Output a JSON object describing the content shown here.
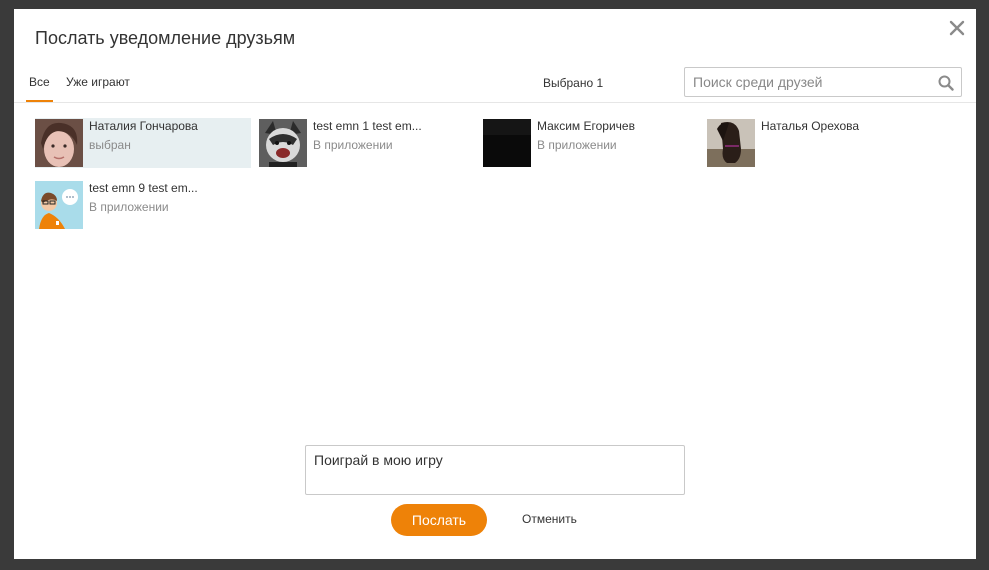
{
  "dialog": {
    "title": "Послать уведомление друзьям",
    "close_icon": "close-icon"
  },
  "tabs": [
    {
      "label": "Все",
      "active": true
    },
    {
      "label": "Уже играют",
      "active": false
    }
  ],
  "selected_count_label": "Выбрано 1",
  "search": {
    "placeholder": "Поиск среди друзей",
    "icon": "search-icon"
  },
  "friends": [
    {
      "name": "Наталия Гончарова",
      "status": "выбран",
      "selected": true
    },
    {
      "name": "test emn 1 test em...",
      "status": "В приложении",
      "selected": false
    },
    {
      "name": "Максим Егоричев",
      "status": "В приложении",
      "selected": false
    },
    {
      "name": "Наталья Орехова",
      "status": "",
      "selected": false
    },
    {
      "name": "test emn 9 test em...",
      "status": "В приложении",
      "selected": false
    }
  ],
  "message": {
    "value": "Поиграй в мою игру"
  },
  "buttons": {
    "send": "Послать",
    "cancel": "Отменить"
  },
  "colors": {
    "accent": "#ee8208",
    "selected_bg": "#e7eff1",
    "overlay": "#3a3a3a"
  }
}
